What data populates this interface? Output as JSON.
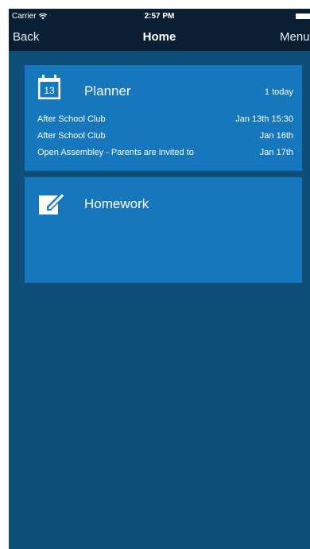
{
  "status_bar": {
    "carrier": "Carrier",
    "time": "2:57 PM",
    "icons": [
      "wifi-icon",
      "battery-icon"
    ]
  },
  "nav": {
    "back_label": "Back",
    "title": "Home",
    "menu_label": "Menu"
  },
  "planner": {
    "title": "Planner",
    "icon_day": "13",
    "count_label": "1 today",
    "events": [
      {
        "name": "After School Club",
        "date": "Jan 13th 15:30"
      },
      {
        "name": "After School Club",
        "date": "Jan 16th"
      },
      {
        "name": "Open Assembley - Parents are invited to",
        "date": "Jan 17th"
      }
    ]
  },
  "homework": {
    "title": "Homework",
    "icon": "edit-icon"
  },
  "colors": {
    "background": "#0e4e79",
    "bar": "#0a1f33",
    "tile": "#1677bd",
    "text": "#ffffff"
  }
}
